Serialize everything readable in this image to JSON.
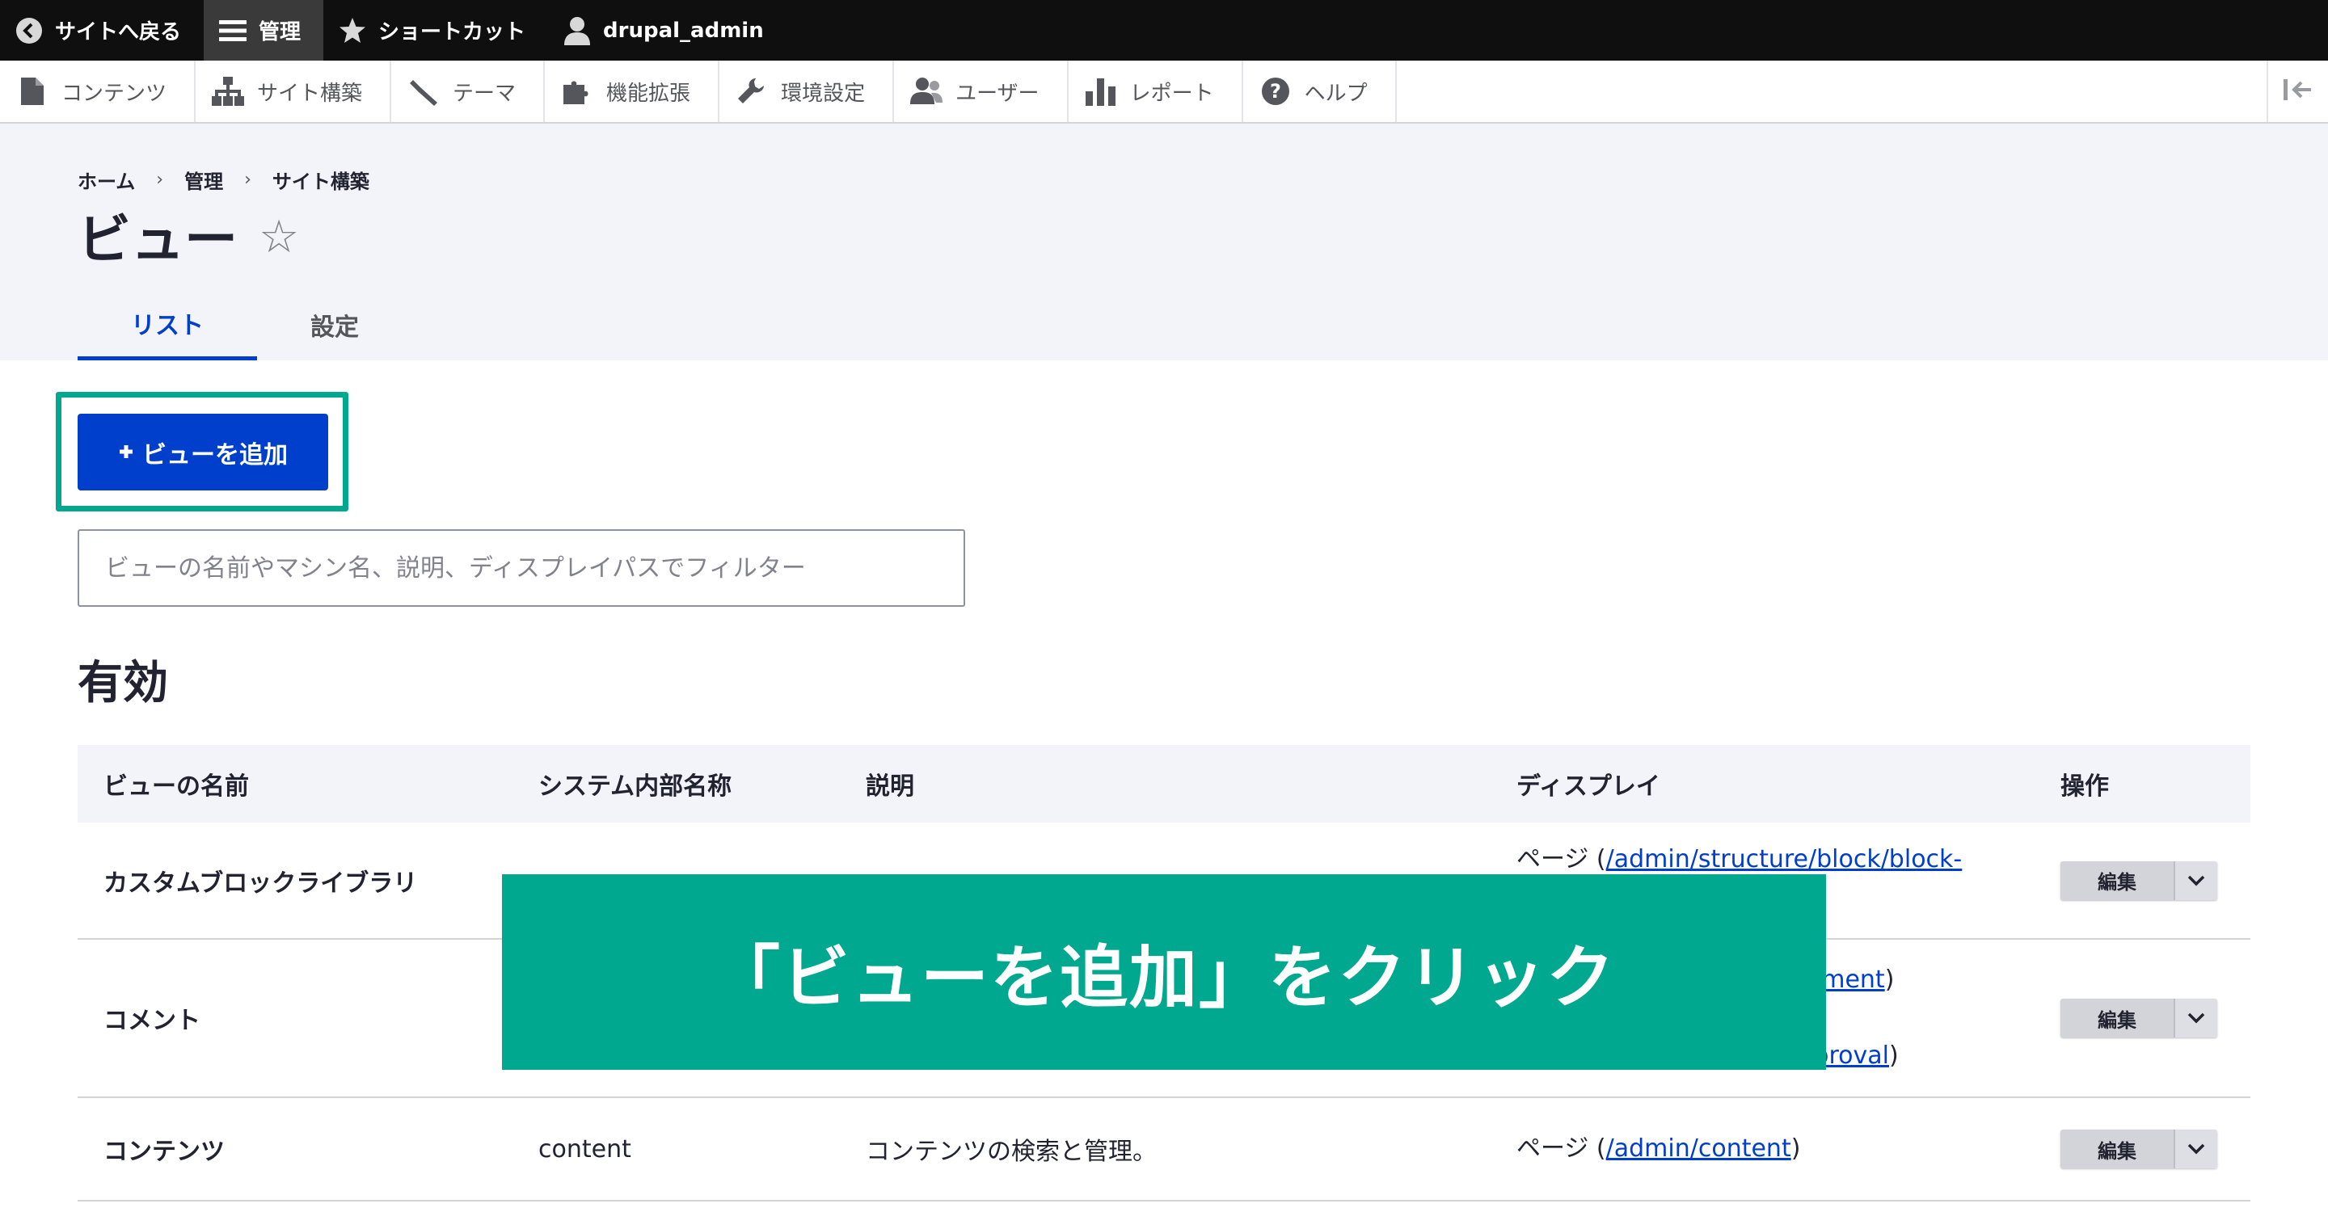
{
  "toolbar": {
    "back_label": "サイトへ戻る",
    "manage_label": "管理",
    "shortcuts_label": "ショートカット",
    "user_label": "drupal_admin"
  },
  "tray": {
    "items": [
      {
        "label": "コンテンツ",
        "icon": "file-icon"
      },
      {
        "label": "サイト構築",
        "icon": "sitemap-icon"
      },
      {
        "label": "テーマ",
        "icon": "paintbrush-icon"
      },
      {
        "label": "機能拡張",
        "icon": "puzzle-icon"
      },
      {
        "label": "環境設定",
        "icon": "wrench-icon"
      },
      {
        "label": "ユーザー",
        "icon": "people-icon"
      },
      {
        "label": "レポート",
        "icon": "bar-chart-icon"
      },
      {
        "label": "ヘルプ",
        "icon": "help-icon"
      }
    ]
  },
  "breadcrumb": [
    "ホーム",
    "管理",
    "サイト構築"
  ],
  "page": {
    "title": "ビュー",
    "tabs": [
      "リスト",
      "設定"
    ],
    "add_button": "ビューを追加",
    "filter_placeholder": "ビューの名前やマシン名、説明、ディスプレイパスでフィルター",
    "section_title": "有効"
  },
  "table": {
    "headers": [
      "ビューの名前",
      "システム内部名称",
      "説明",
      "ディスプレイ",
      "操作"
    ],
    "rows": [
      {
        "name": "カスタムブロックライブラリ",
        "machine": "",
        "description": "",
        "display_prefix": "ページ (",
        "display_link": "/admin/structure/block/block-",
        "display_suffix": "",
        "op": "編集"
      },
      {
        "name": "コメント",
        "machine": "",
        "description": "",
        "display_link1": "mment",
        "display_suffix1": ")",
        "display_link2": "approval",
        "display_suffix2": ")",
        "op": "編集"
      },
      {
        "name": "コンテンツ",
        "machine": "content",
        "description": "コンテンツの検索と管理。",
        "display_prefix": "ページ (",
        "display_link": "/admin/content",
        "display_suffix": ")",
        "op": "編集"
      }
    ]
  },
  "banner": {
    "text": "「ビューを追加」をクリック"
  },
  "colors": {
    "accent": "#003ecc",
    "highlight": "#00a88f",
    "toolbar_bg": "#0f0f0f"
  }
}
